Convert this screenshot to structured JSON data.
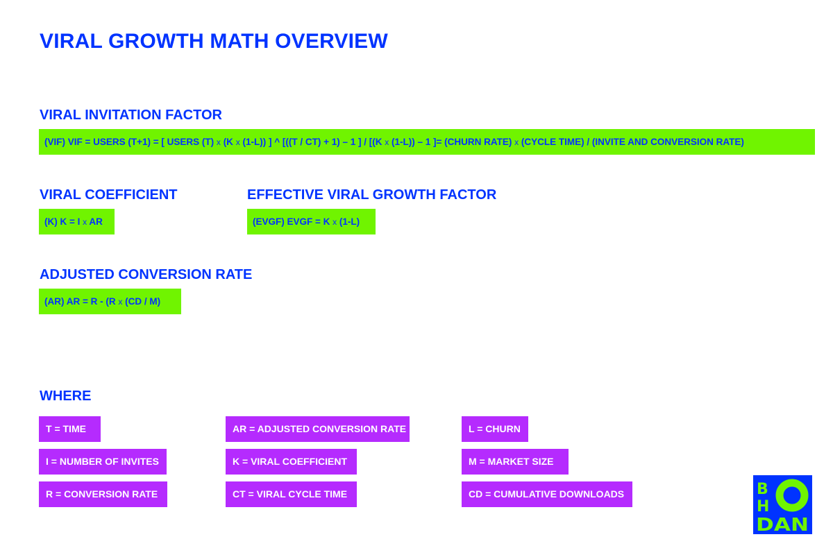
{
  "page": {
    "title": "VIRAL GROWTH MATH OVERVIEW"
  },
  "sections": {
    "vif": {
      "heading": "VIRAL INVITATION FACTOR",
      "formula": "(VIF) VIF = USERS (T+1) = [ USERS (T) x (K x (1-L)) ] ^ [((T / CT) + 1) – 1 ] / [(K x (1-L)) – 1 ]= (CHURN RATE) x (CYCLE TIME) / (INVITE AND CONVERSION RATE)"
    },
    "k": {
      "heading": "VIRAL COEFFICIENT",
      "formula": "(K) K = I x AR"
    },
    "evgf": {
      "heading": "EFFECTIVE VIRAL GROWTH FACTOR",
      "formula": "(EVGF) EVGF = K x (1-L)"
    },
    "ar": {
      "heading": "ADJUSTED CONVERSION RATE",
      "formula": "(AR) AR = R - (R x (CD / M)"
    }
  },
  "where": {
    "heading": "WHERE",
    "definitions": [
      "T = TIME",
      "I = NUMBER OF INVITES",
      "R = CONVERSION RATE",
      "AR = ADJUSTED CONVERSION RATE",
      "K = VIRAL COEFFICIENT",
      "CT = VIRAL CYCLE TIME",
      "L = CHURN",
      "M = MARKET SIZE",
      "CD = CUMULATIVE DOWNLOADS"
    ]
  },
  "logo": {
    "letters": [
      "B",
      "H",
      "O",
      "DAN"
    ],
    "icon": "bohdan-logo-icon"
  },
  "colors": {
    "primary_blue": "#0033ff",
    "formula_green": "#70f400",
    "definition_purple": "#b52bfe",
    "background": "#ffffff"
  }
}
